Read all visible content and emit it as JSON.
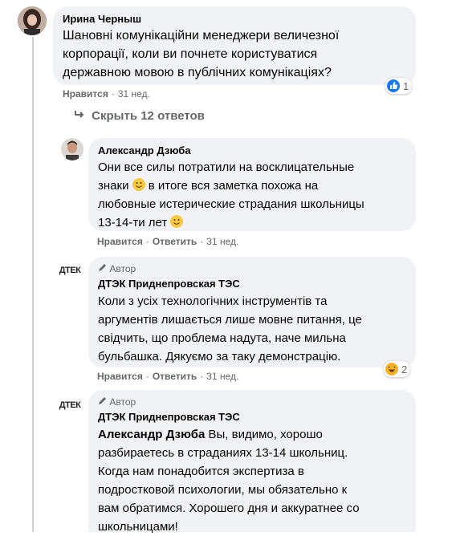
{
  "comment": {
    "author": "Ирина Черныш",
    "lines": [
      "Шановні комунікаційни менеджери величезної",
      "корпорації, коли ви почнете користуватися",
      "державною мовою в публічних комунікаціях?"
    ],
    "like_label": "Нравится",
    "time": "31 нед.",
    "reaction_count": "1"
  },
  "hide_replies": "Скрыть 12 ответов",
  "replies": [
    {
      "author": "Александр Дзюба",
      "lines": [
        "Они все силы потратили на восклицательные",
        "знаки",
        "в итоге вся заметка похожа на",
        "любовные истерические страдания школьницы",
        "13-14-ти лет"
      ],
      "like_label": "Нравится",
      "reply_label": "Ответить",
      "time": "31 нед."
    },
    {
      "badge": "Автор",
      "author": "ДТЭК Приднепровская ТЭС",
      "logo": "ДТЕК",
      "lines": [
        "Коли з усіх технологічних інструментів та",
        "аргументів лишається лише мовне питання, це",
        "свідчить, що проблема надута, наче мильна",
        "бульбашка. Дякуємо за таку демонстрацію."
      ],
      "like_label": "Нравится",
      "reply_label": "Ответить",
      "time": "31 нед.",
      "reaction_count": "2"
    },
    {
      "badge": "Автор",
      "author": "ДТЭК Приднепровская ТЭС",
      "logo": "ДТЕК",
      "mention": "Александр Дзюба",
      "lines": [
        "Вы, видимо, хорошо",
        "разбираетесь в страданиях 13-14 школьниц.",
        "Когда нам понадобится экспертиза в",
        "подростковой психологии, мы обязательно к",
        "вам обратимся. Хорошего дня и аккуратнее со",
        "школьницами!"
      ]
    }
  ],
  "icons": {
    "like": "thumbs-up-icon",
    "haha": "laughing-face-icon",
    "emoji": "smiling-face-icon",
    "hide": "return-arrow-icon",
    "author": "pencil-icon"
  },
  "colors": {
    "bubble": "#f0f2f5",
    "meta": "#65676b",
    "like": "#1877f2",
    "haha": "#f7b125"
  }
}
